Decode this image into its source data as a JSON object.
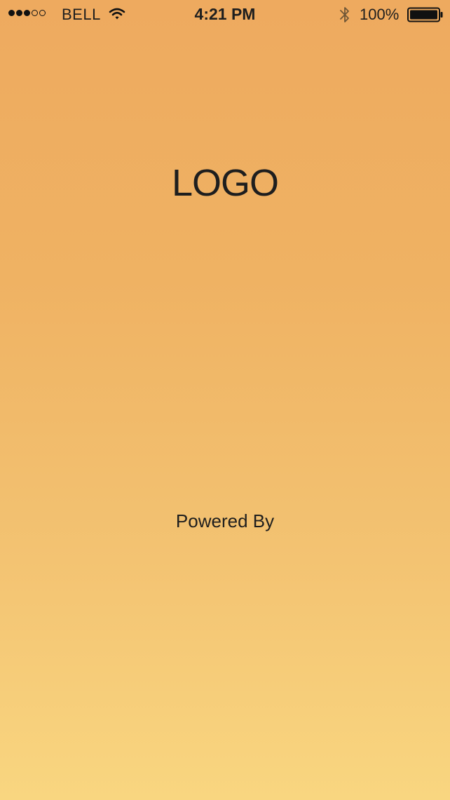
{
  "status_bar": {
    "signal": {
      "filled": 3,
      "total": 5
    },
    "carrier": "BELL",
    "wifi_icon": "wifi-icon",
    "time": "4:21 PM",
    "bluetooth_icon": "bluetooth-icon",
    "battery_percent": "100%",
    "battery_level": 1.0
  },
  "splash": {
    "logo_text": "LOGO",
    "powered_by": "Powered By"
  },
  "colors": {
    "gradient_top": "#EEAA5F",
    "gradient_bottom": "#F9D680",
    "text": "#1E1E1E"
  }
}
